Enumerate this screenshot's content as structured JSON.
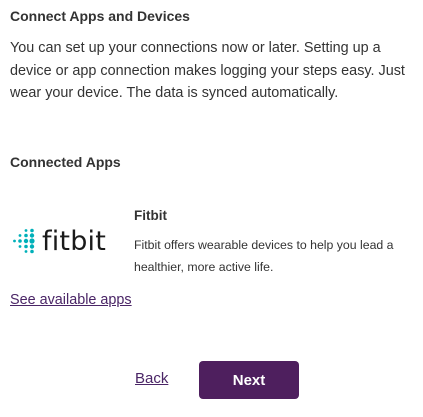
{
  "connect": {
    "title": "Connect Apps and Devices",
    "intro": "You can set up your connections now or later. Setting up a device or app connection makes logging your steps easy. Just wear your device. The data is synced automatically."
  },
  "connected_apps": {
    "heading": "Connected Apps",
    "items": [
      {
        "logo_text": "fitbit",
        "logo_icon": "fitbit-dots-icon",
        "name": "Fitbit",
        "description": "Fitbit offers wearable devices to help you lead a healthier, more active life."
      }
    ],
    "see_available_label": "See available apps"
  },
  "footer": {
    "back_label": "Back",
    "next_label": "Next"
  },
  "colors": {
    "primary": "#4e1f5e",
    "link": "#4a2566",
    "fitbit_teal": "#00b0b9",
    "text": "#333333"
  }
}
